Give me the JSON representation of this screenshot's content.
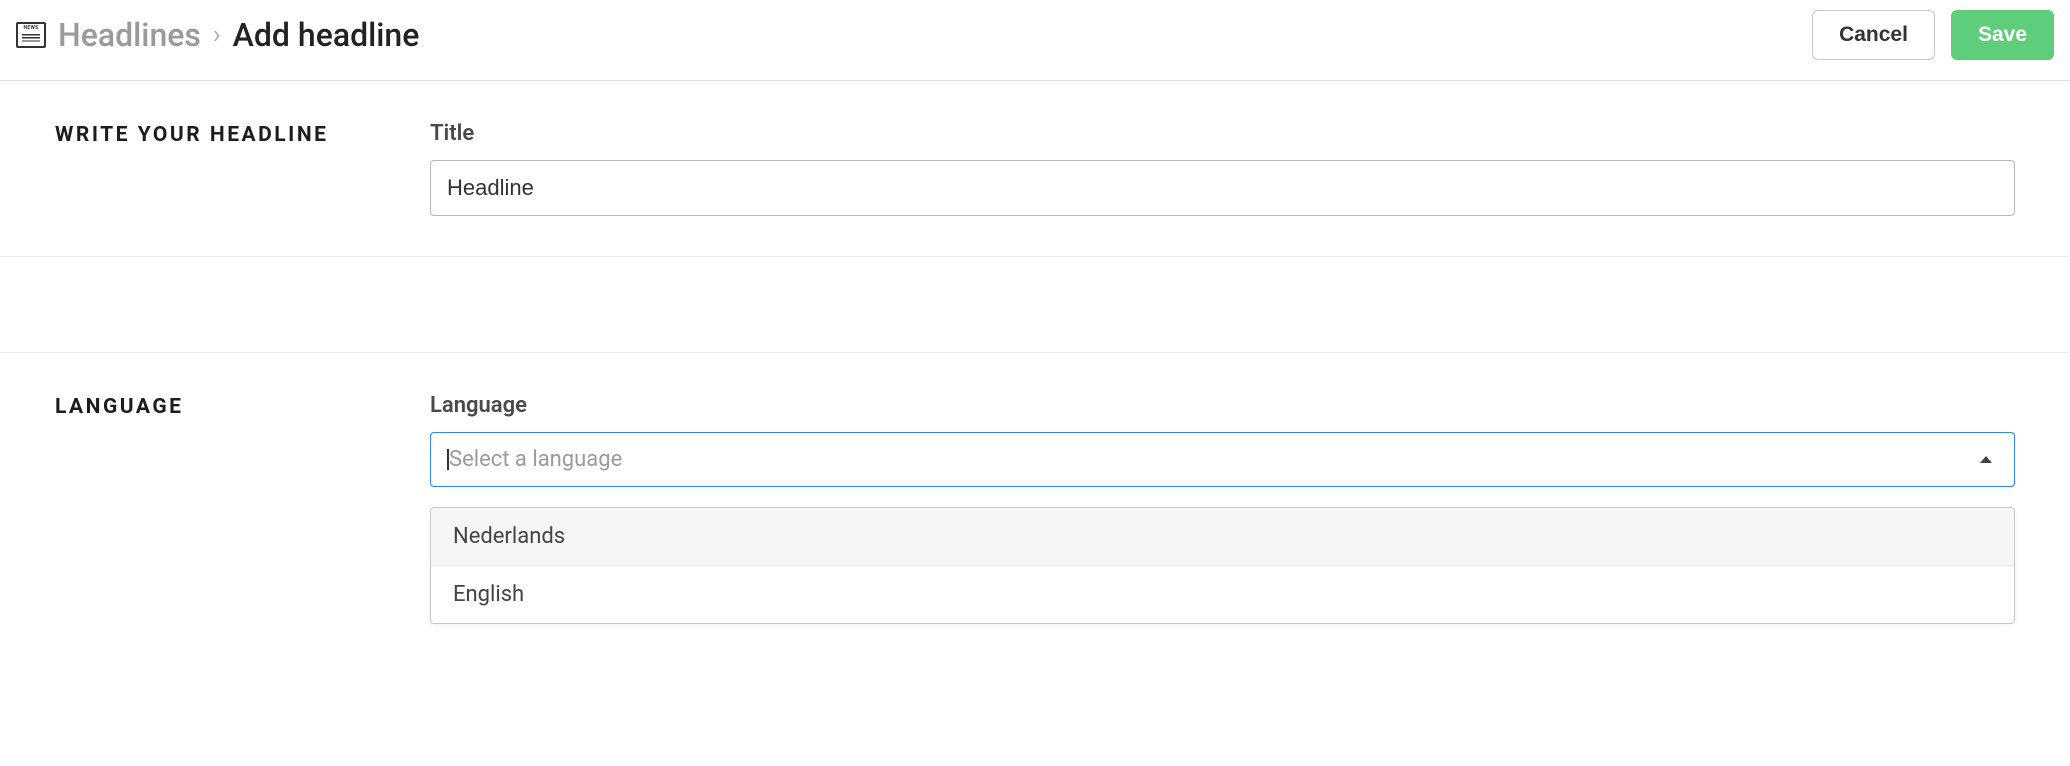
{
  "header": {
    "breadcrumb_root": "Headlines",
    "breadcrumb_sep": "›",
    "breadcrumb_current": "Add headline",
    "cancel_label": "Cancel",
    "save_label": "Save"
  },
  "sections": {
    "headline": {
      "label": "WRITE YOUR HEADLINE",
      "field_label": "Title",
      "value": "Headline"
    },
    "language": {
      "label": "LANGUAGE",
      "field_label": "Language",
      "placeholder": "Select a language",
      "options": [
        "Nederlands",
        "English"
      ]
    }
  }
}
